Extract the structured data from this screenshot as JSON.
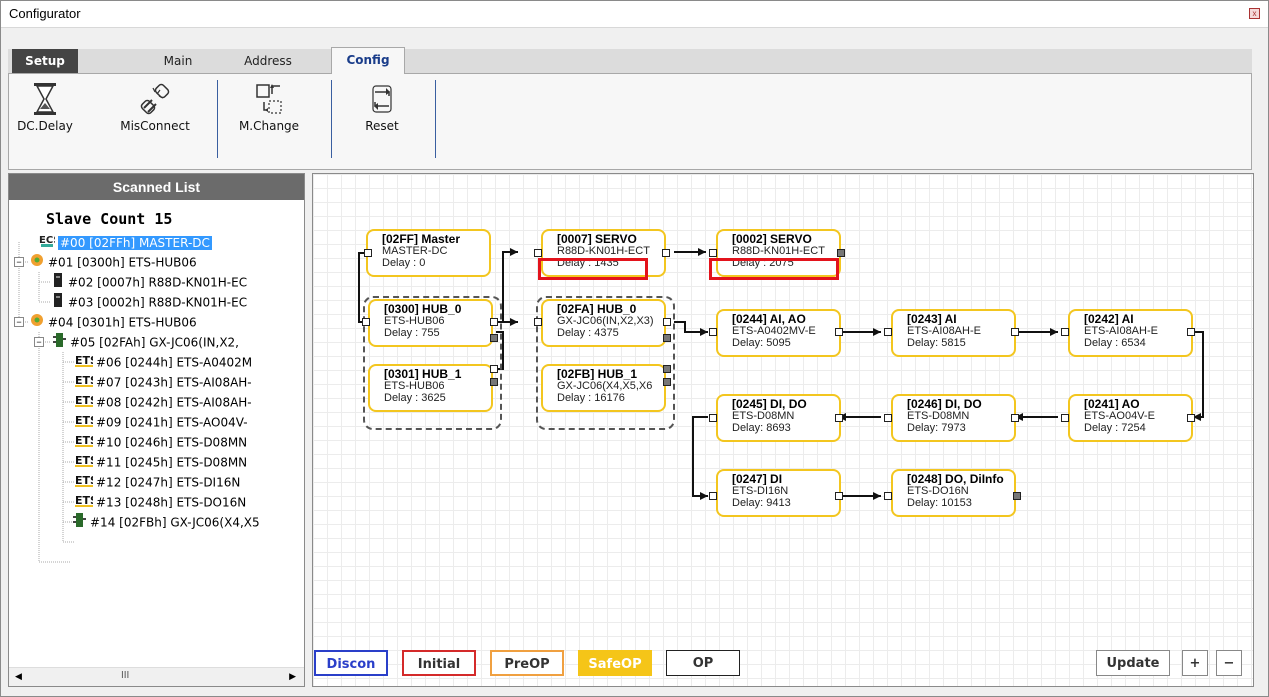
{
  "window": {
    "title": "Configurator"
  },
  "tabs": [
    {
      "label": "Setup"
    },
    {
      "label": "Main"
    },
    {
      "label": "Address"
    },
    {
      "label": "Config"
    }
  ],
  "toolbar": {
    "dc_delay": "DC.Delay",
    "misconnect": "MisConnect",
    "m_change": "M.Change",
    "reset": "Reset"
  },
  "scanned_list": {
    "title": "Scanned List",
    "slave_count": "Slave Count  15",
    "items": [
      {
        "text": "#00  [02FFh] MASTER-DC",
        "icon": "ecs-master-icon"
      },
      {
        "text": "#01  [0300h] ETS-HUB06",
        "icon": "hub-icon"
      },
      {
        "text": "#02  [0007h] R88D-KN01H-EC",
        "icon": "servo-icon"
      },
      {
        "text": "#03  [0002h] R88D-KN01H-EC",
        "icon": "servo-icon"
      },
      {
        "text": "#04  [0301h] ETS-HUB06",
        "icon": "hub-icon"
      },
      {
        "text": "#05  [02FAh] GX-JC06(IN,X2,",
        "icon": "junction-icon"
      },
      {
        "text": "#06  [0244h] ETS-A0402M",
        "icon": "ets-icon"
      },
      {
        "text": "#07  [0243h] ETS-AI08AH-",
        "icon": "ets-icon"
      },
      {
        "text": "#08  [0242h] ETS-AI08AH-",
        "icon": "ets-icon"
      },
      {
        "text": "#09  [0241h] ETS-AO04V-",
        "icon": "ets-icon"
      },
      {
        "text": "#10  [0246h] ETS-D08MN",
        "icon": "ets-icon"
      },
      {
        "text": "#11  [0245h] ETS-D08MN",
        "icon": "ets-icon"
      },
      {
        "text": "#12  [0247h] ETS-DI16N",
        "icon": "ets-icon"
      },
      {
        "text": "#13  [0248h] ETS-DO16N",
        "icon": "ets-icon"
      },
      {
        "text": "#14  [02FBh] GX-JC06(X4,X5",
        "icon": "junction-icon"
      }
    ],
    "scroll_thumb": "III"
  },
  "nodes": [
    {
      "title": "[02FF] Master",
      "model": "MASTER-DC",
      "delay": "Delay : 0"
    },
    {
      "title": "[0007] SERVO",
      "model": "R88D-KN01H-ECT",
      "delay": "Delay : 1435"
    },
    {
      "title": "[0002] SERVO",
      "model": "R88D-KN01H-ECT",
      "delay": "Delay : 2075"
    },
    {
      "title": "[0300] HUB_0",
      "model": "ETS-HUB06",
      "delay": "Delay : 755"
    },
    {
      "title": "[0301] HUB_1",
      "model": "ETS-HUB06",
      "delay": "Delay : 3625"
    },
    {
      "title": "[02FA] HUB_0",
      "model": "GX-JC06(IN,X2,X3)",
      "delay": "Delay : 4375"
    },
    {
      "title": "[02FB] HUB_1",
      "model": "GX-JC06(X4,X5,X6",
      "delay": "Delay : 16176"
    },
    {
      "title": "[0244] AI, AO",
      "model": "ETS-A0402MV-E",
      "delay": "Delay: 5095"
    },
    {
      "title": "[0243] AI",
      "model": "ETS-AI08AH-E",
      "delay": "Delay: 5815"
    },
    {
      "title": "[0242] AI",
      "model": "ETS-AI08AH-E",
      "delay": "Delay : 6534"
    },
    {
      "title": "[0245] DI, DO",
      "model": "ETS-D08MN",
      "delay": "Delay: 8693"
    },
    {
      "title": "[0246] DI, DO",
      "model": "ETS-D08MN",
      "delay": "Delay: 7973"
    },
    {
      "title": "[0241] AO",
      "model": "ETS-AO04V-E",
      "delay": "Delay : 7254"
    },
    {
      "title": "[0247] DI",
      "model": "ETS-DI16N",
      "delay": "Delay: 9413"
    },
    {
      "title": "[0248] DO, DiInfo",
      "model": "ETS-DO16N",
      "delay": "Delay: 10153"
    }
  ],
  "states": [
    {
      "label": "Discon",
      "color": "#2a3fc9"
    },
    {
      "label": "Initial",
      "color": "#d42a2a"
    },
    {
      "label": "PreOP",
      "color": "#f0a040"
    },
    {
      "label": "SafeOP",
      "color": "#f5c518"
    },
    {
      "label": "OP",
      "color": "#222222"
    }
  ],
  "actions": {
    "update": "Update",
    "zoom_in": "+",
    "zoom_out": "−"
  }
}
